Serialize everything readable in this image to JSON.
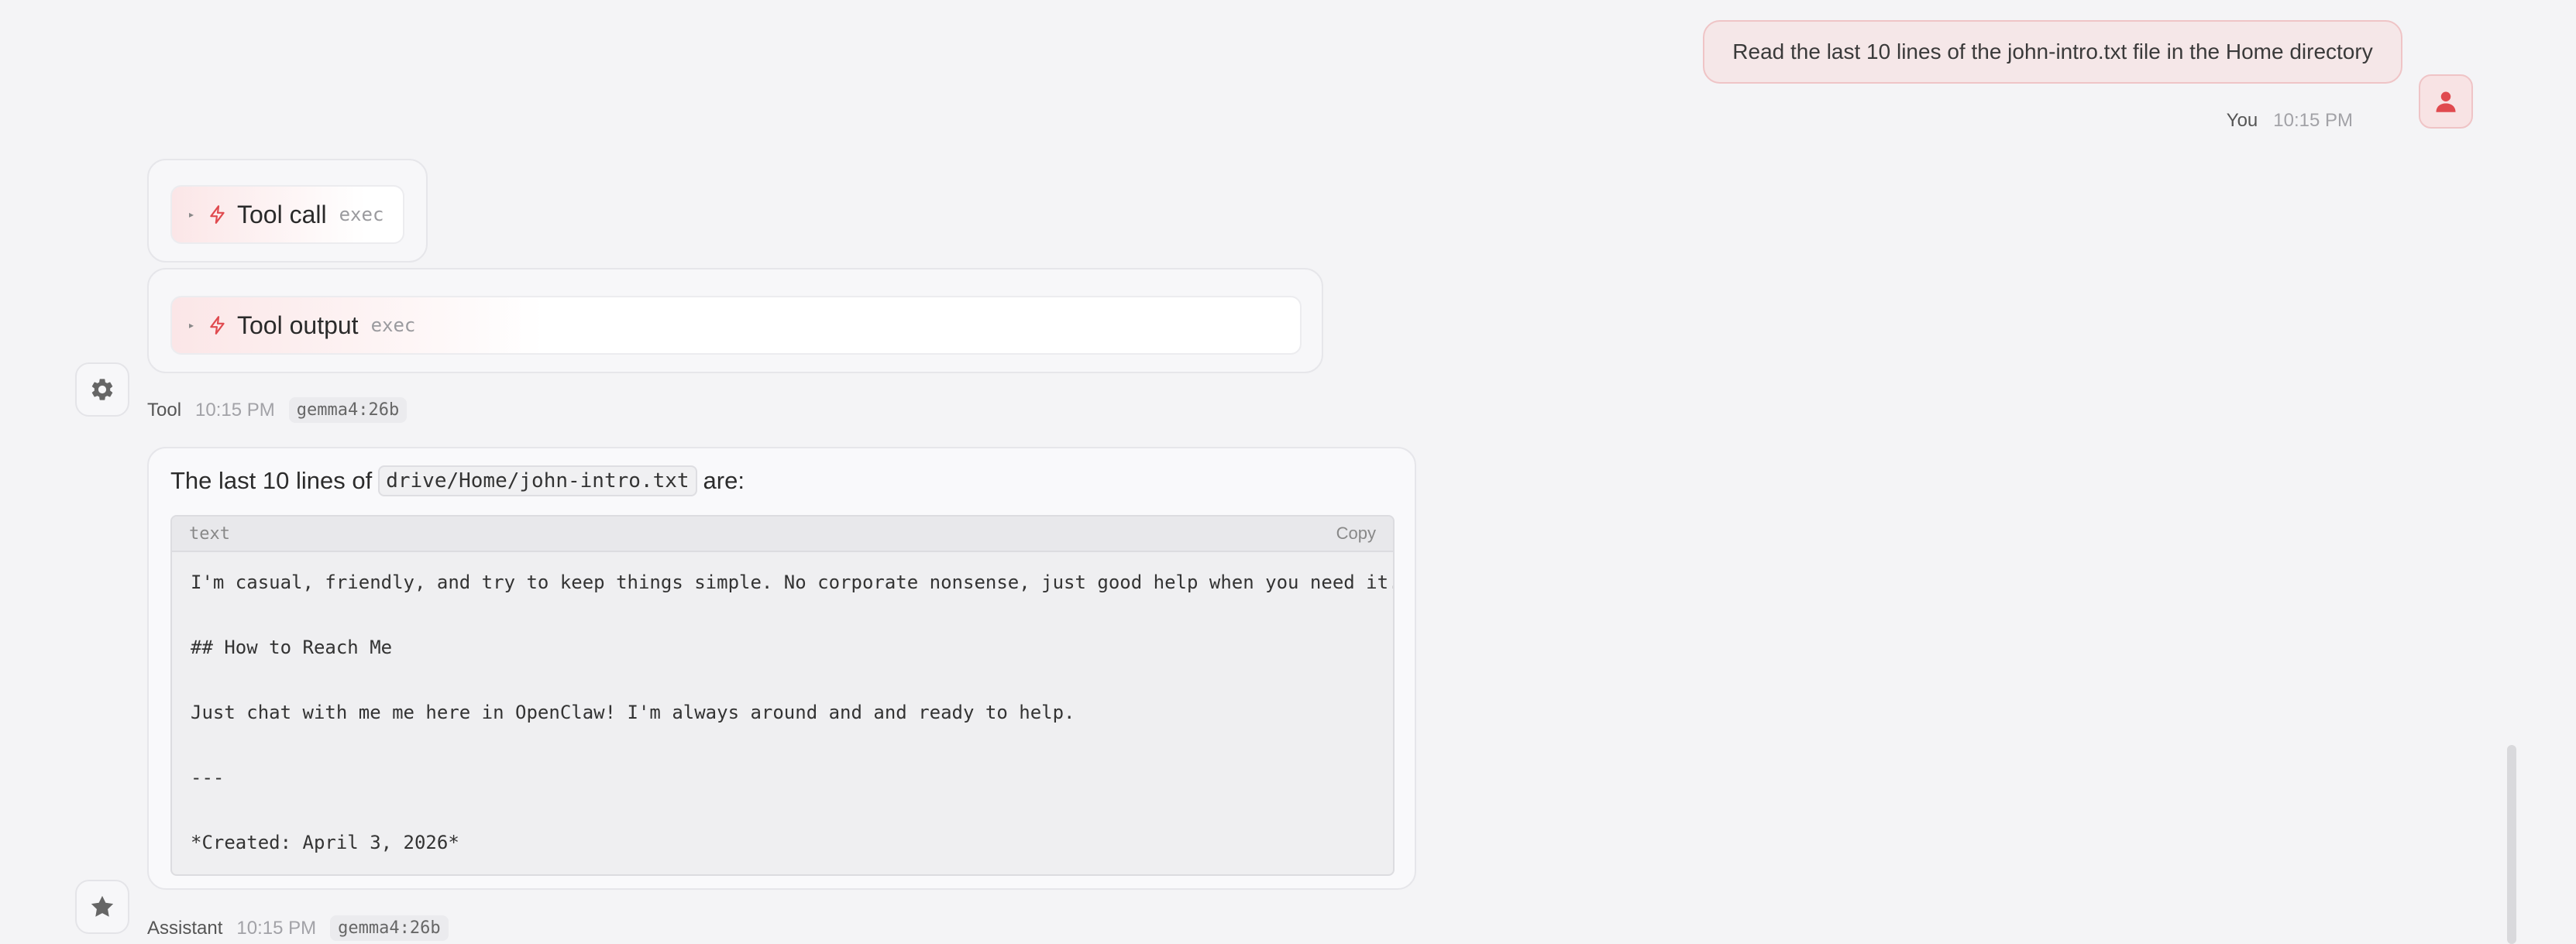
{
  "user_message": {
    "text": "Read the last 10 lines of the john-intro.txt file in the Home directory",
    "sender": "You",
    "time": "10:15 PM"
  },
  "tool_call": {
    "title": "Tool call",
    "subtitle": "exec"
  },
  "tool_output": {
    "title": "Tool output",
    "subtitle": "exec"
  },
  "tool_meta": {
    "sender": "Tool",
    "time": "10:15 PM",
    "model": "gemma4:26b"
  },
  "assistant": {
    "intro_prefix": "The last 10 lines of",
    "file_path": "drive/Home/john-intro.txt",
    "intro_suffix": "are:",
    "code": {
      "language": "text",
      "copy_label": "Copy",
      "lines": [
        "I'm casual, friendly, and try to keep things simple. No corporate nonsense, just good help when you need it.",
        "",
        "## How to Reach Me",
        "",
        "Just chat with me me here in OpenClaw! I'm always around and and ready to help.",
        "",
        "---",
        "",
        "*Created: April 3, 2026*"
      ]
    },
    "meta": {
      "sender": "Assistant",
      "time": "10:15 PM",
      "model": "gemma4:26b"
    }
  },
  "icons": {
    "user": "person-icon",
    "tool": "gear-icon",
    "assistant": "star-icon",
    "tool_call": "bolt-icon",
    "expand": "triangle-right-icon"
  },
  "colors": {
    "accent": "#e04a4f",
    "user_bubble": "#f5e7e8",
    "background": "#f4f4f6"
  }
}
